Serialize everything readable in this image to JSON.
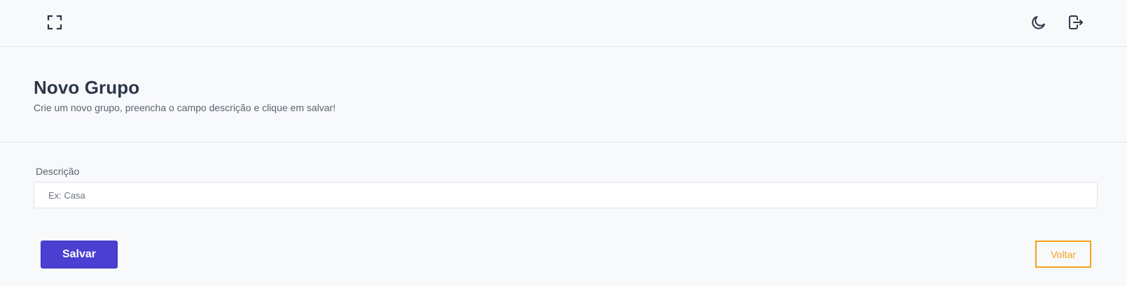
{
  "topbar": {
    "left_icons": [
      "fullscreen-icon"
    ],
    "right_icons": [
      "moon-icon",
      "logout-icon"
    ],
    "icon_color": "#2d3748"
  },
  "header": {
    "title": "Novo Grupo",
    "subtitle": "Crie um novo grupo, preencha o campo descrição e clique em salvar!"
  },
  "form": {
    "description_label": "Descrição",
    "description_placeholder": "Ex: Casa",
    "description_value": ""
  },
  "actions": {
    "save_label": "Salvar",
    "back_label": "Voltar",
    "save_color": "#4a3fd1",
    "back_color": "#f5a11c"
  }
}
